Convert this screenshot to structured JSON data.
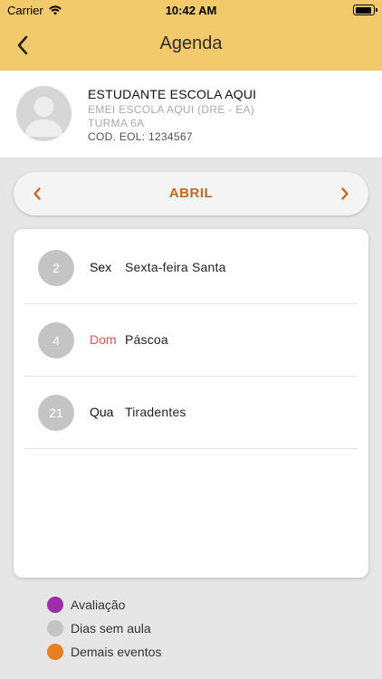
{
  "status_bar": {
    "carrier": "Carrier",
    "time": "10:42 AM"
  },
  "nav": {
    "title": "Agenda",
    "back_icon": "chevron-left-icon"
  },
  "student": {
    "name": "ESTUDANTE ESCOLA AQUI",
    "school": "EMEI ESCOLA AQUI (DRE - EA)",
    "class": "TURMA 6A",
    "eol_code": "COD. EOL: 1234567",
    "avatar_icon": "user-avatar-icon"
  },
  "month_selector": {
    "label": "ABRIL",
    "prev_icon": "chevron-left-icon",
    "next_icon": "chevron-right-icon",
    "accent_color": "#c2691f"
  },
  "events": [
    {
      "day": "2",
      "weekday": "Sex",
      "name": "Sexta-feira Santa",
      "is_sunday": false
    },
    {
      "day": "4",
      "weekday": "Dom",
      "name": "Páscoa",
      "is_sunday": true
    },
    {
      "day": "21",
      "weekday": "Qua",
      "name": "Tiradentes",
      "is_sunday": false
    }
  ],
  "legend": [
    {
      "label": "Avaliação",
      "color": "#9c2ea8"
    },
    {
      "label": "Dias sem aula",
      "color": "#c4c4c4"
    },
    {
      "label": "Demais eventos",
      "color": "#e67e22"
    }
  ],
  "colors": {
    "header_bg": "#f2c96b",
    "sunday": "#d9534f"
  }
}
